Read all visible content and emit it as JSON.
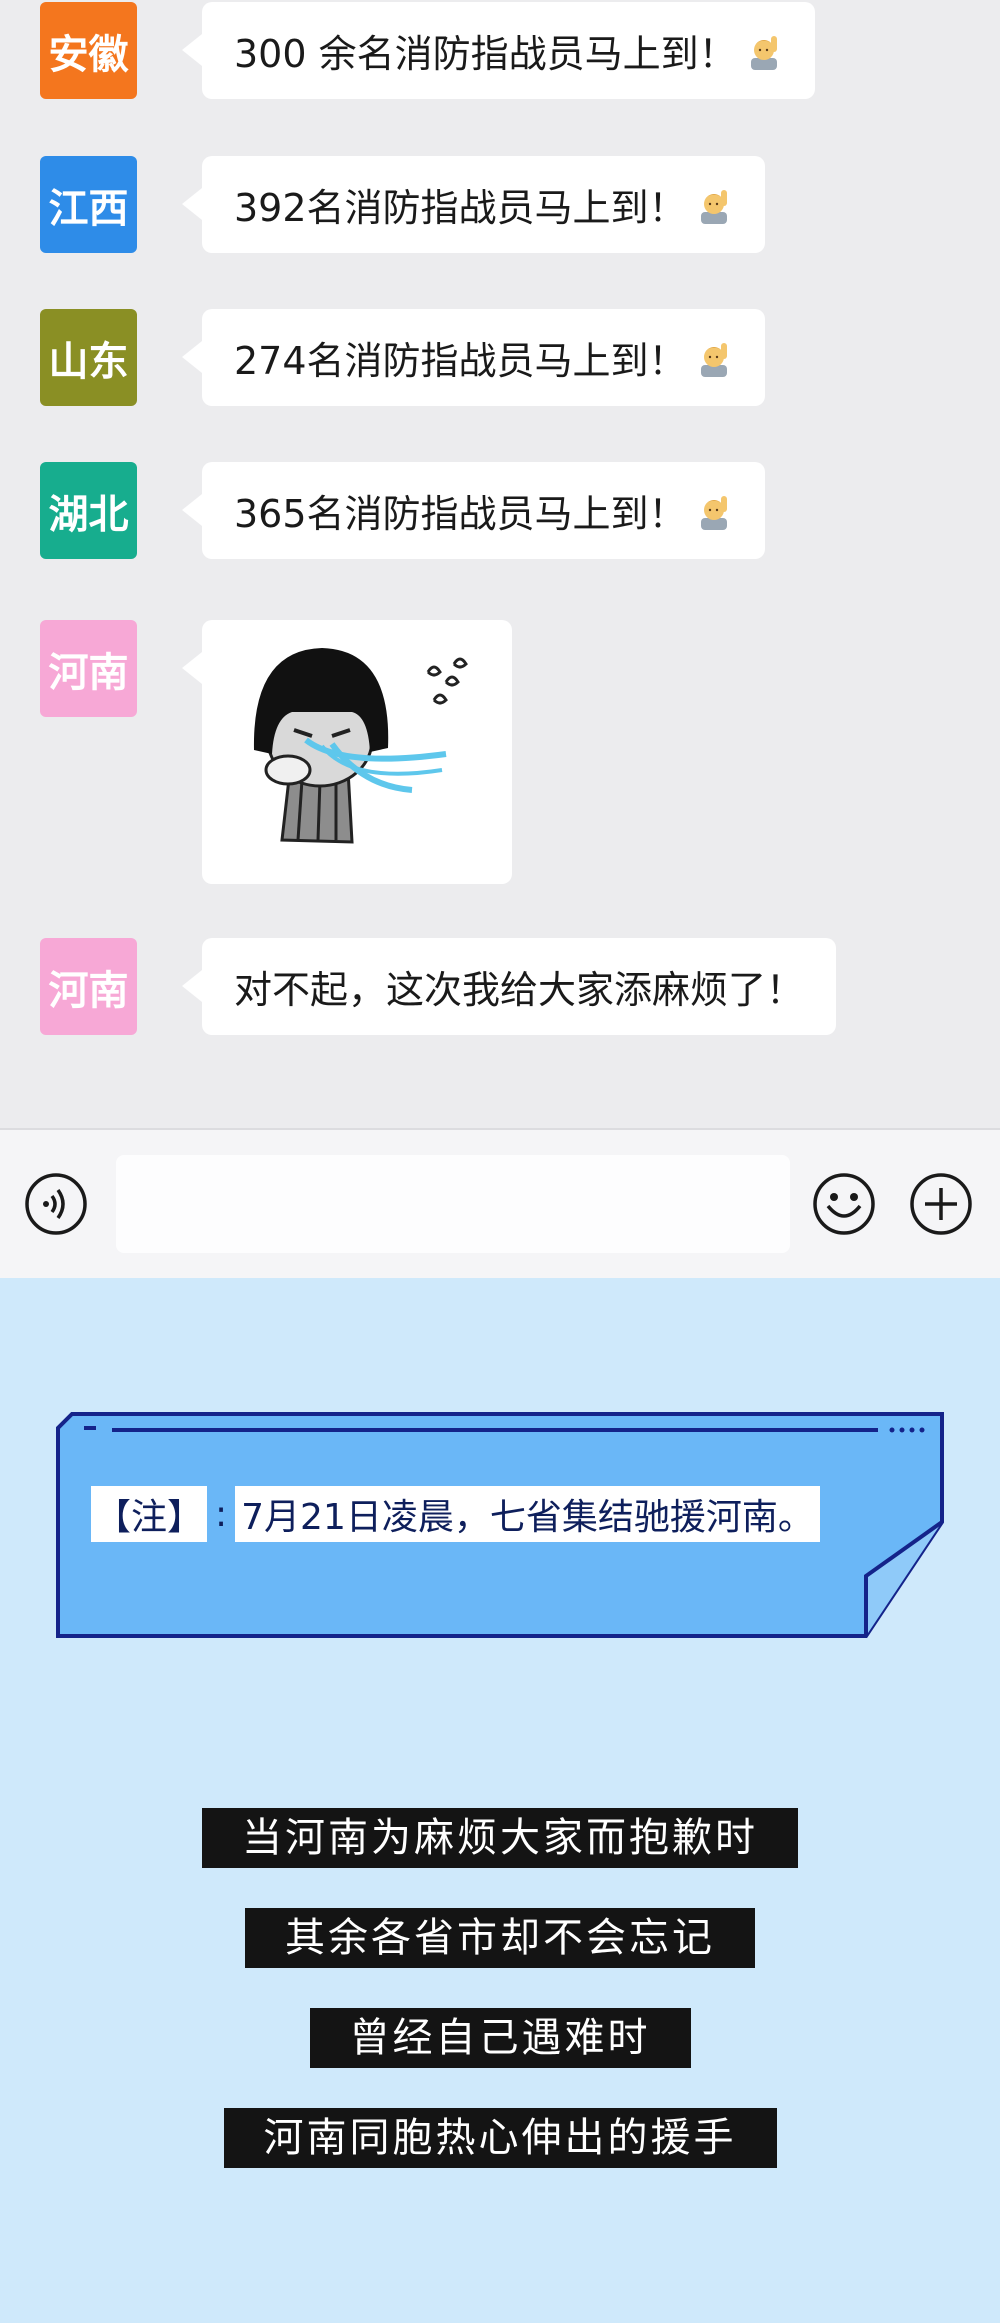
{
  "messages": [
    {
      "sender": "安徽",
      "color": "#f4761e",
      "text": "300 余名消防指战员马上到！",
      "emoji": "saluting-person-icon"
    },
    {
      "sender": "江西",
      "color": "#2e8ce8",
      "text": "392名消防指战员马上到！",
      "emoji": "saluting-person-icon"
    },
    {
      "sender": "山东",
      "color": "#8a8f24",
      "text": "274名消防指战员马上到！",
      "emoji": "saluting-person-icon"
    },
    {
      "sender": "湖北",
      "color": "#17ad8e",
      "text": "365名消防指战员马上到！",
      "emoji": "saluting-person-icon"
    },
    {
      "sender": "河南",
      "color": "#f7a8d6",
      "sticker": "crying-sticker"
    },
    {
      "sender": "河南",
      "color": "#f7a8d6",
      "text": "对不起，这次我给大家添麻烦了！"
    }
  ],
  "inputbar": {
    "voice_icon": "voice-icon",
    "emoji_icon": "smiley-icon",
    "plus_icon": "plus-icon",
    "placeholder": ""
  },
  "note": {
    "label": "【注】",
    "colon": ":",
    "body": "7月21日凌晨，七省集结驰援河南。"
  },
  "captions": [
    "当河南为麻烦大家而抱歉时",
    "其余各省市却不会忘记",
    "曾经自己遇难时",
    "河南同胞热心伸出的援手"
  ],
  "colors": {
    "chat_bg": "#ececee",
    "page_bg": "#cfe9fb",
    "note_fill": "#6ab7f7",
    "note_border": "#14238a"
  }
}
